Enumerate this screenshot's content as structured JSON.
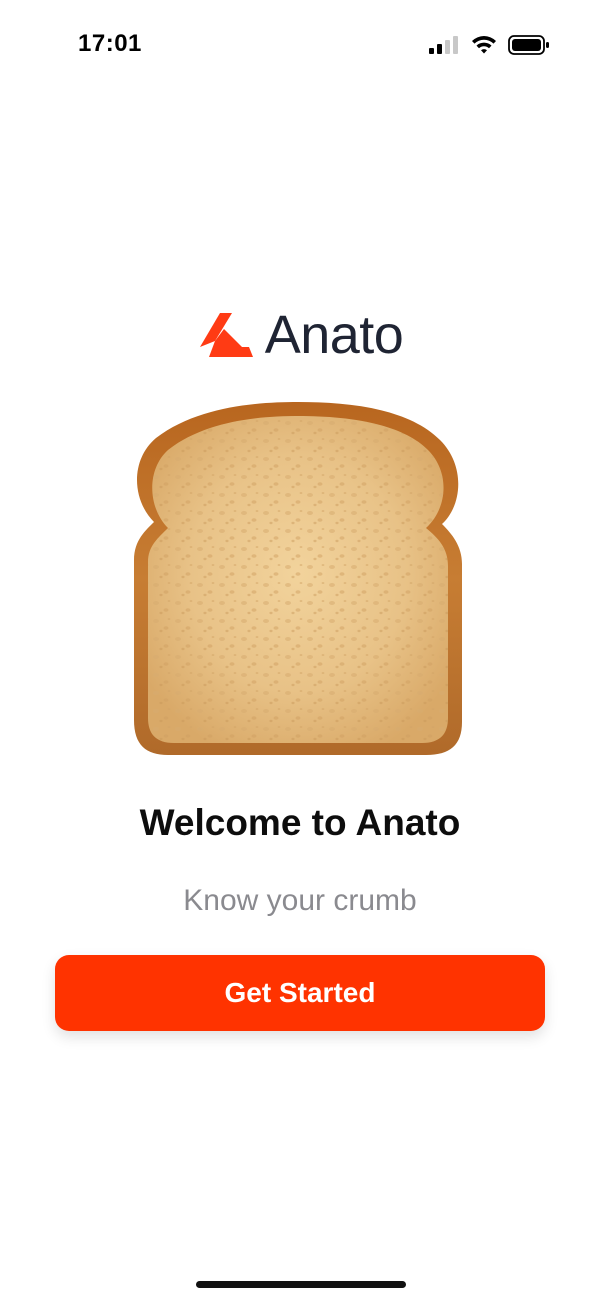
{
  "status_bar": {
    "time": "17:01",
    "icons": [
      "signal-icon",
      "wifi-icon",
      "battery-icon"
    ]
  },
  "logo": {
    "text": "Anato",
    "icon": "anato-mark-icon",
    "mark_color": "#ff3b14",
    "text_color": "#1f2433"
  },
  "hero": {
    "icon": "bread-slice-illustration"
  },
  "welcome": {
    "title": "Welcome to Anato",
    "subtitle": "Know your crumb"
  },
  "cta": {
    "label": "Get Started",
    "color": "#ff3300"
  }
}
